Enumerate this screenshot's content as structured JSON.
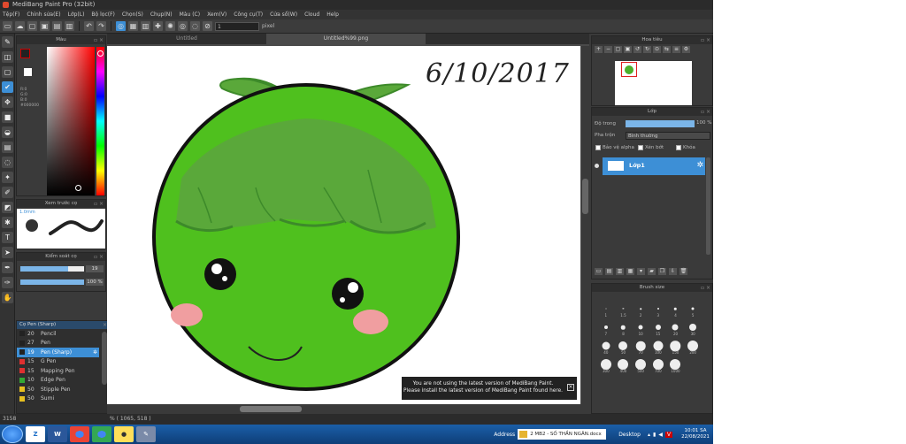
{
  "window": {
    "title": "MediBang Paint Pro (32bit)"
  },
  "menu": [
    "Tệp(F)",
    "Chỉnh sửa(E)",
    "Lớp(L)",
    "Bộ lọc(F)",
    "Chọn(S)",
    "Chụp(N)",
    "Màu (C)",
    "Xem(V)",
    "Công cụ(T)",
    "Cửa sổ(W)",
    "Cloud",
    "Help"
  ],
  "toolbar": {
    "size_value": "1",
    "unit": "pixel"
  },
  "tools": [
    "brush-icon",
    "eraser-icon",
    "select-rect-icon",
    "check-icon",
    "move-icon",
    "fill-icon",
    "bucket-icon",
    "gradient-icon",
    "lasso-icon",
    "magic-wand-icon",
    "select-pen-icon",
    "select-eraser-icon",
    "stamp-icon",
    "text-icon",
    "operation-icon",
    "eyedropper-icon",
    "pen-tool-icon",
    "hand-icon"
  ],
  "color": {
    "title": "Màu",
    "info": [
      "R:0",
      "G:0",
      "B:0",
      "#000000"
    ],
    "fg": "#222222",
    "bg": "#ffffff"
  },
  "preview": {
    "title": "Xem trước cọ",
    "size_label": "1.0mm"
  },
  "brush_control": {
    "title": "Kiểm soát cọ",
    "size": "19",
    "opacity": "100 %",
    "size_pct": 0.75
  },
  "brush_list": {
    "title": "Cọ Pen (Sharp)",
    "items": [
      {
        "size": "20",
        "name": "Pencil",
        "color": "#222222"
      },
      {
        "size": "27",
        "name": "Pen",
        "color": "#222222"
      },
      {
        "size": "19",
        "name": "Pen (Sharp)",
        "color": "#222222",
        "selected": true
      },
      {
        "size": "15",
        "name": "G Pen",
        "color": "#e03030"
      },
      {
        "size": "15",
        "name": "Mapping Pen",
        "color": "#e03030"
      },
      {
        "size": "10",
        "name": "Edge Pen",
        "color": "#34a834"
      },
      {
        "size": "50",
        "name": "Stipple Pen",
        "color": "#e8c020"
      },
      {
        "size": "50",
        "name": "Sumi",
        "color": "#e8c020"
      }
    ]
  },
  "tabs": [
    "Untitled",
    "Untitled%99.png"
  ],
  "notice": {
    "line1": "You are not using the latest version of MediBang Paint.",
    "line2": "Please install the latest version of MediBang Paint found here."
  },
  "canvas": {
    "handwriting": "6/10/2017"
  },
  "navigator": {
    "title": "Hoa tiêu"
  },
  "layer": {
    "title": "Lớp",
    "opacity_label": "Độ trong",
    "opacity_value": "100 %",
    "opacity_pct": 1.0,
    "blend_label": "Pha trộn",
    "blend_value": "Bình thường",
    "checks": [
      "Bảo vệ alpha",
      "Xén bớt",
      "Khóa"
    ],
    "layer_name": "Lớp1"
  },
  "brush_size": {
    "title": "Brush size",
    "sizes": [
      [
        "1",
        1
      ],
      [
        "1.5",
        1.2
      ],
      [
        "2",
        1.5
      ],
      [
        "3",
        2
      ],
      [
        "4",
        2.5
      ],
      [
        "5",
        3
      ],
      [
        "7",
        4
      ],
      [
        "8",
        4.5
      ],
      [
        "10",
        5
      ],
      [
        "15",
        6
      ],
      [
        "20",
        7
      ],
      [
        "30",
        8
      ],
      [
        "40",
        9
      ],
      [
        "50",
        10
      ],
      [
        "70",
        10.5
      ],
      [
        "100",
        11
      ],
      [
        "150",
        11.5
      ],
      [
        "200",
        12
      ],
      [
        "300",
        12
      ],
      [
        "400",
        12
      ],
      [
        "500",
        12
      ],
      [
        "700",
        12
      ],
      [
        "1000",
        12
      ]
    ]
  },
  "status": {
    "zoom": "3158",
    "coords": "% ( 1065, 518 )"
  },
  "taskbar": {
    "address_label": "Address",
    "address_value": "2 MB2 - SỐ THẦN NGÂN.docx",
    "desktop": "Desktop",
    "time": "10:01 SA",
    "date": "22/08/2021"
  }
}
